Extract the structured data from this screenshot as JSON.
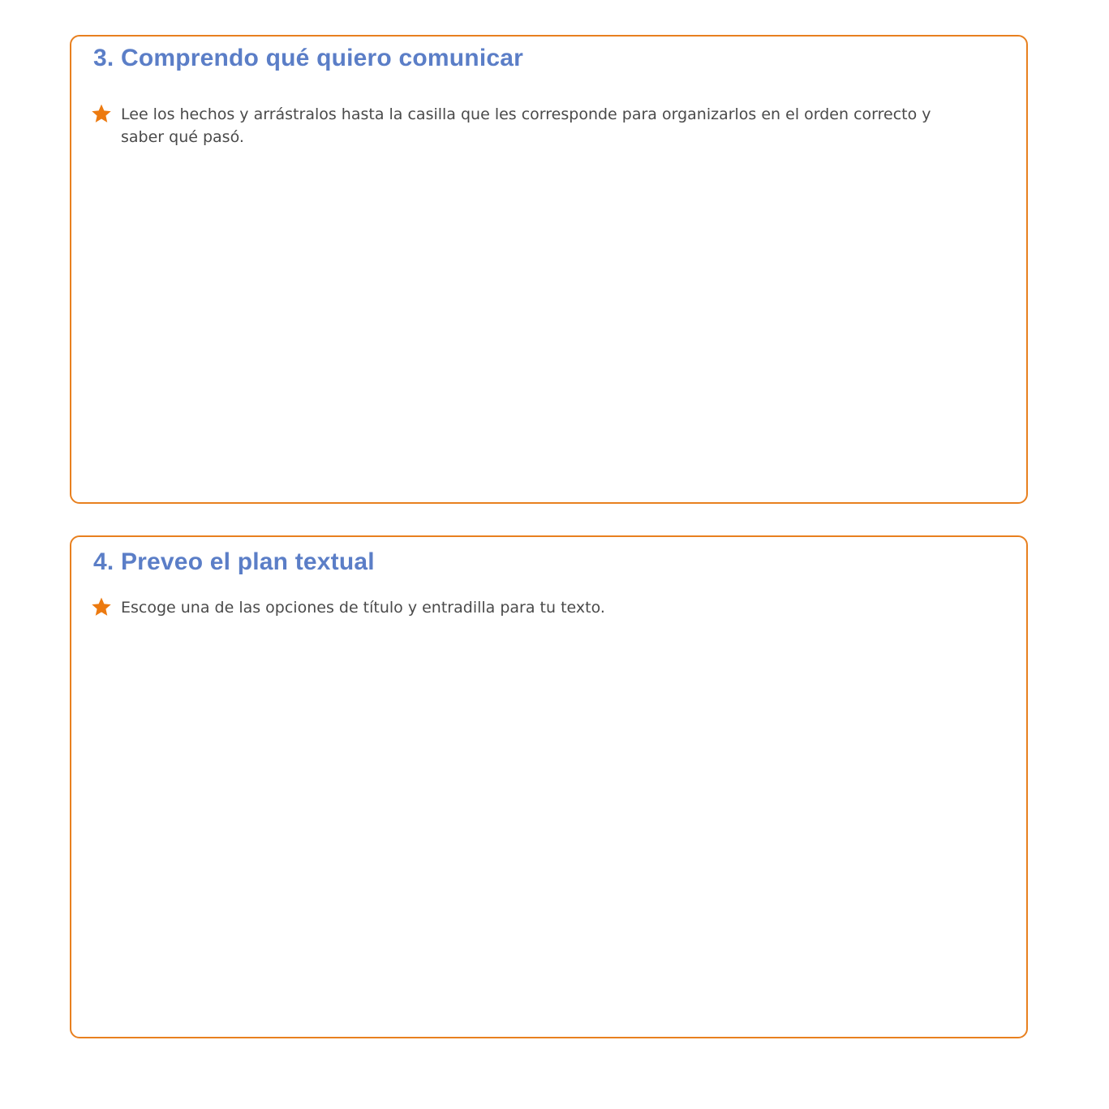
{
  "sections": [
    {
      "title": "3. Comprendo qué quiero comunicar",
      "instruction": "Lee los hechos y arrástralos hasta la casilla que les corresponde para organizarlos en el orden correcto y saber qué pasó.",
      "icon": "star-icon"
    },
    {
      "title": "4. Preveo el plan textual",
      "instruction": "Escoge una de las opciones de título y entradilla para tu texto.",
      "icon": "star-icon"
    }
  ],
  "colors": {
    "border": "#e8801f",
    "title": "#5b7ec7",
    "star": "#ec7a10",
    "text": "#4a4a4a"
  }
}
